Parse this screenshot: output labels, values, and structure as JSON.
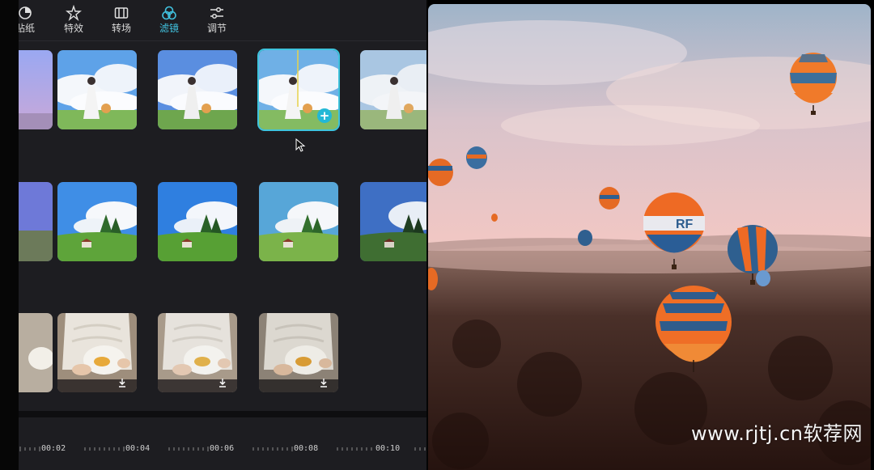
{
  "tabs": [
    {
      "label": "贴纸",
      "icon": "sticker-icon"
    },
    {
      "label": "特效",
      "icon": "sparkle-star-icon"
    },
    {
      "label": "转场",
      "icon": "transition-icon"
    },
    {
      "label": "滤镜",
      "icon": "filter-circles-icon",
      "active": true
    },
    {
      "label": "调节",
      "icon": "sliders-icon"
    }
  ],
  "accent_color": "#41c2df",
  "filter_rows": [
    {
      "theme": "girl-in-white-dress-clouds",
      "items": 5,
      "selected_index": 3
    },
    {
      "theme": "green-field-house-sky",
      "items": 5
    },
    {
      "theme": "hands-holding-plate",
      "items": 4,
      "download_badges": true
    }
  ],
  "timeline": {
    "labels": [
      "00:02",
      "00:04",
      "00:06",
      "00:08",
      "00:10"
    ]
  },
  "preview": {
    "description_icon": "hot-air-balloons-preview",
    "balloon_text": "RF"
  },
  "watermark": "www.rjtj.cn软荐网"
}
